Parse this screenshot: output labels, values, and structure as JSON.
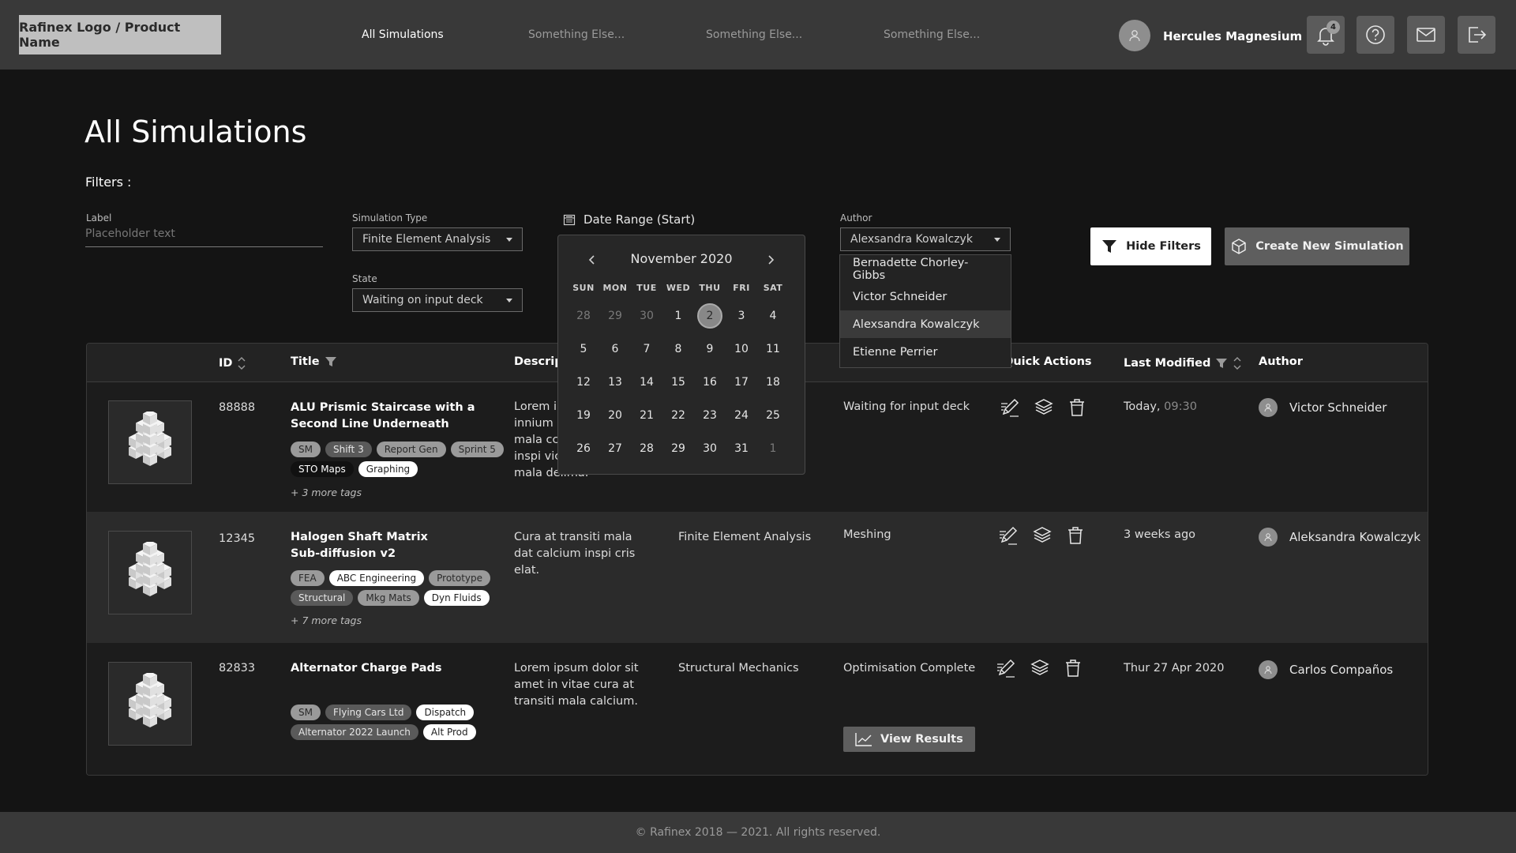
{
  "header": {
    "logo": "Rafinex Logo / Product Name",
    "nav": [
      "All Simulations",
      "Something Else...",
      "Something Else...",
      "Something Else..."
    ],
    "user_name": "Hercules Magnesium",
    "notification_count": "4"
  },
  "page": {
    "title": "All Simulations",
    "filters_label": "Filters :"
  },
  "filters": {
    "label_label": "Label",
    "label_placeholder": "Placeholder text",
    "sim_type_label": "Simulation Type",
    "sim_type_value": "Finite Element Analysis",
    "state_label": "State",
    "state_value": "Waiting on input deck",
    "date_label": "Date Range (Start)",
    "author_label": "Author",
    "author_value": "Alexsandra Kowalczyk",
    "author_options": [
      "Bernadette Chorley-Gibbs",
      "Victor Schneider",
      "Alexsandra Kowalczyk",
      "Etienne Perrier"
    ],
    "hide_filters": "Hide Filters",
    "create": "Create New Simulation"
  },
  "calendar": {
    "month": "November 2020",
    "dow": [
      "SUN",
      "MON",
      "TUE",
      "WED",
      "THU",
      "FRI",
      "SAT"
    ],
    "weeks": [
      [
        "28",
        "29",
        "30",
        "1",
        "2",
        "3",
        "4"
      ],
      [
        "5",
        "6",
        "7",
        "8",
        "9",
        "10",
        "11"
      ],
      [
        "12",
        "13",
        "14",
        "15",
        "16",
        "17",
        "18"
      ],
      [
        "19",
        "20",
        "21",
        "22",
        "23",
        "24",
        "25"
      ],
      [
        "26",
        "27",
        "28",
        "29",
        "30",
        "31",
        "1"
      ]
    ],
    "selected": "2"
  },
  "table": {
    "headers": {
      "id": "ID",
      "title": "Title",
      "description": "Descrip",
      "quick_actions": "Quick Actions",
      "last_modified": "Last Modified",
      "author": "Author"
    },
    "rows": [
      {
        "id": "88888",
        "title_line1": "ALU Prismic Staircase with a",
        "title_line2": "Second Line Underneath",
        "tags": [
          "SM",
          "Shift 3",
          "Report Gen",
          "Sprint 5",
          "STO Maps",
          "Graphing"
        ],
        "more_tags": "+ 3 more tags",
        "description": [
          "Lorem ip",
          "innium c",
          "mala cc",
          "inspi vic",
          "mala delima."
        ],
        "type": "",
        "state": "Waiting for input deck",
        "modified": "Today,",
        "modified_time": "09:30",
        "author": "Victor Schneider"
      },
      {
        "id": "12345",
        "title_line1": "Halogen Shaft Matrix",
        "title_line2": "Sub-diffusion v2",
        "tags": [
          "FEA",
          "ABC Engineering",
          "Prototype",
          "Structural",
          "Mkg Mats",
          "Dyn Fluids"
        ],
        "more_tags": "+ 7 more tags",
        "description": [
          "Cura at transiti mala",
          "dat calcium inspi cris",
          "elat."
        ],
        "type": "Finite Element Analysis",
        "state": "Meshing",
        "modified": "3 weeks ago",
        "modified_time": "",
        "author": "Aleksandra Kowalczyk"
      },
      {
        "id": "82833",
        "title_line1": "Alternator Charge Pads",
        "title_line2": "",
        "tags": [
          "SM",
          "Flying Cars Ltd",
          "Dispatch",
          "Alternator 2022 Launch",
          "Alt Prod"
        ],
        "more_tags": "",
        "description": [
          "Lorem ipsum dolor sit",
          "amet in vitae cura at",
          "transiti mala calcium."
        ],
        "type": "Structural Mechanics",
        "state": "Optimisation Complete",
        "modified": "Thur 27 Apr 2020",
        "modified_time": "",
        "author": "Carlos Compaños",
        "view_results": "View Results"
      }
    ]
  },
  "footer": "© Rafinex 2018 — 2021. All rights reserved.",
  "colors": {
    "background": "#141414",
    "header": "#393939",
    "row_alt": "#2b2b2b",
    "accent_white": "#ffffff"
  }
}
